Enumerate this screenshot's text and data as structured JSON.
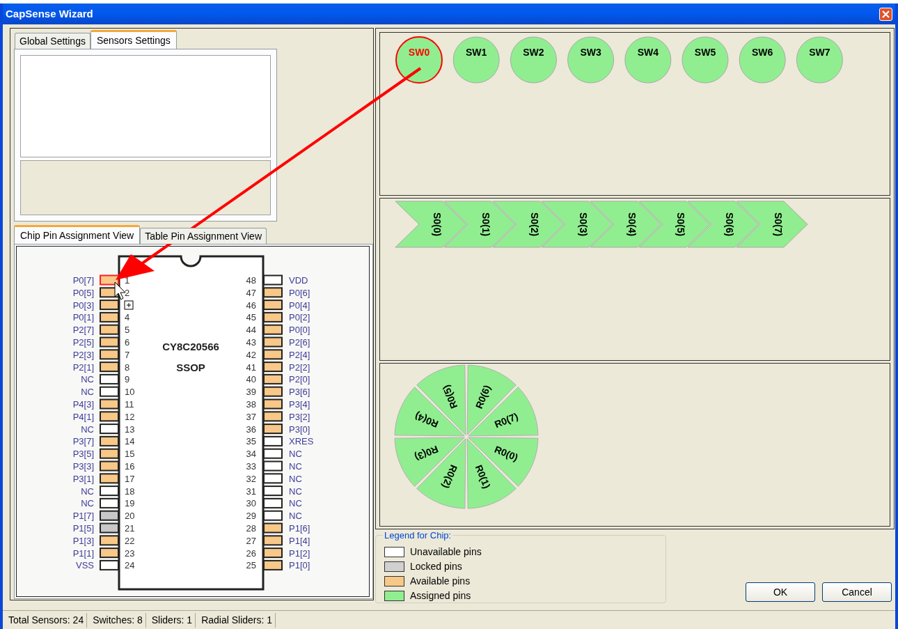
{
  "window": {
    "title": "CapSense Wizard"
  },
  "settings_tabs": [
    {
      "label": "Global Settings",
      "selected": false
    },
    {
      "label": "Sensors Settings",
      "selected": true
    }
  ],
  "view_tabs": [
    {
      "label": "Chip Pin Assignment View",
      "selected": true
    },
    {
      "label": "Table Pin Assignment View",
      "selected": false
    }
  ],
  "chip": {
    "name": "CY8C20566",
    "package": "SSOP",
    "left_pins": [
      {
        "label": "P0[7]",
        "number": "1",
        "kind": "available",
        "selected": true
      },
      {
        "label": "P0[5]",
        "number": "2",
        "kind": "available",
        "selected": false
      },
      {
        "label": "P0[3]",
        "kind": "available",
        "selected": false
      },
      {
        "label": "P0[1]",
        "number": "4",
        "kind": "available",
        "selected": false
      },
      {
        "label": "P2[7]",
        "number": "5",
        "kind": "available",
        "selected": false
      },
      {
        "label": "P2[5]",
        "number": "6",
        "kind": "available",
        "selected": false
      },
      {
        "label": "P2[3]",
        "number": "7",
        "kind": "available",
        "selected": false
      },
      {
        "label": "P2[1]",
        "number": "8",
        "kind": "available",
        "selected": false
      },
      {
        "label": "NC",
        "number": "9",
        "kind": "unavailable",
        "selected": false
      },
      {
        "label": "NC",
        "number": "10",
        "kind": "unavailable",
        "selected": false
      },
      {
        "label": "P4[3]",
        "number": "11",
        "kind": "available",
        "selected": false
      },
      {
        "label": "P4[1]",
        "number": "12",
        "kind": "available",
        "selected": false
      },
      {
        "label": "NC",
        "number": "13",
        "kind": "unavailable",
        "selected": false
      },
      {
        "label": "P3[7]",
        "number": "14",
        "kind": "available",
        "selected": false
      },
      {
        "label": "P3[5]",
        "number": "15",
        "kind": "available",
        "selected": false
      },
      {
        "label": "P3[3]",
        "number": "16",
        "kind": "available",
        "selected": false
      },
      {
        "label": "P3[1]",
        "number": "17",
        "kind": "available",
        "selected": false
      },
      {
        "label": "NC",
        "number": "18",
        "kind": "unavailable",
        "selected": false
      },
      {
        "label": "NC",
        "number": "19",
        "kind": "unavailable",
        "selected": false
      },
      {
        "label": "P1[7]",
        "number": "20",
        "kind": "locked",
        "selected": false
      },
      {
        "label": "P1[5]",
        "number": "21",
        "kind": "locked",
        "selected": false
      },
      {
        "label": "P1[3]",
        "number": "22",
        "kind": "available",
        "selected": false
      },
      {
        "label": "P1[1]",
        "number": "23",
        "kind": "available",
        "selected": false
      },
      {
        "label": "VSS",
        "number": "24",
        "kind": "unavailable",
        "selected": false
      }
    ],
    "right_pins": [
      {
        "label": "VDD",
        "number": "48",
        "kind": "unavailable",
        "selected": false
      },
      {
        "label": "P0[6]",
        "number": "47",
        "kind": "available",
        "selected": false
      },
      {
        "label": "P0[4]",
        "number": "46",
        "kind": "available",
        "selected": false
      },
      {
        "label": "P0[2]",
        "number": "45",
        "kind": "available",
        "selected": false
      },
      {
        "label": "P0[0]",
        "number": "44",
        "kind": "available",
        "selected": false
      },
      {
        "label": "P2[6]",
        "number": "43",
        "kind": "available",
        "selected": false
      },
      {
        "label": "P2[4]",
        "number": "42",
        "kind": "available",
        "selected": false
      },
      {
        "label": "P2[2]",
        "number": "41",
        "kind": "available",
        "selected": false
      },
      {
        "label": "P2[0]",
        "number": "40",
        "kind": "available",
        "selected": false
      },
      {
        "label": "P3[6]",
        "number": "39",
        "kind": "available",
        "selected": false
      },
      {
        "label": "P3[4]",
        "number": "38",
        "kind": "available",
        "selected": false
      },
      {
        "label": "P3[2]",
        "number": "37",
        "kind": "available",
        "selected": false
      },
      {
        "label": "P3[0]",
        "number": "36",
        "kind": "available",
        "selected": false
      },
      {
        "label": "XRES",
        "number": "35",
        "kind": "unavailable",
        "selected": false
      },
      {
        "label": "NC",
        "number": "34",
        "kind": "unavailable",
        "selected": false
      },
      {
        "label": "NC",
        "number": "33",
        "kind": "unavailable",
        "selected": false
      },
      {
        "label": "NC",
        "number": "32",
        "kind": "unavailable",
        "selected": false
      },
      {
        "label": "NC",
        "number": "31",
        "kind": "unavailable",
        "selected": false
      },
      {
        "label": "NC",
        "number": "30",
        "kind": "unavailable",
        "selected": false
      },
      {
        "label": "NC",
        "number": "29",
        "kind": "unavailable",
        "selected": false
      },
      {
        "label": "P1[6]",
        "number": "28",
        "kind": "available",
        "selected": false
      },
      {
        "label": "P1[4]",
        "number": "27",
        "kind": "available",
        "selected": false
      },
      {
        "label": "P1[2]",
        "number": "26",
        "kind": "available",
        "selected": false
      },
      {
        "label": "P1[0]",
        "number": "25",
        "kind": "available",
        "selected": false
      }
    ]
  },
  "switches": [
    {
      "label": "SW0",
      "selected": true
    },
    {
      "label": "SW1",
      "selected": false
    },
    {
      "label": "SW2",
      "selected": false
    },
    {
      "label": "SW3",
      "selected": false
    },
    {
      "label": "SW4",
      "selected": false
    },
    {
      "label": "SW5",
      "selected": false
    },
    {
      "label": "SW6",
      "selected": false
    },
    {
      "label": "SW7",
      "selected": false
    }
  ],
  "slider_segments": [
    "S0(0)",
    "S0(1)",
    "S0(2)",
    "S0(3)",
    "S0(4)",
    "S0(5)",
    "S0(6)",
    "S0(7)"
  ],
  "radial_segments": [
    "R0(0)",
    "R0(1)",
    "R0(2)",
    "R0(3)",
    "R0(4)",
    "R0(5)",
    "R0(6)",
    "R0(7)"
  ],
  "legend": {
    "title": "Legend for Chip:",
    "items": [
      {
        "label": "Unavailable pins",
        "color": "#ffffff"
      },
      {
        "label": "Locked pins",
        "color": "#d0d0d0"
      },
      {
        "label": "Available pins",
        "color": "#f8c888"
      },
      {
        "label": "Assigned pins",
        "color": "#90ee90"
      }
    ]
  },
  "buttons": [
    "OK",
    "Cancel"
  ],
  "status_bar": [
    "Total Sensors: 24",
    "Switches: 8",
    "Sliders: 1",
    "Radial Sliders: 1"
  ]
}
